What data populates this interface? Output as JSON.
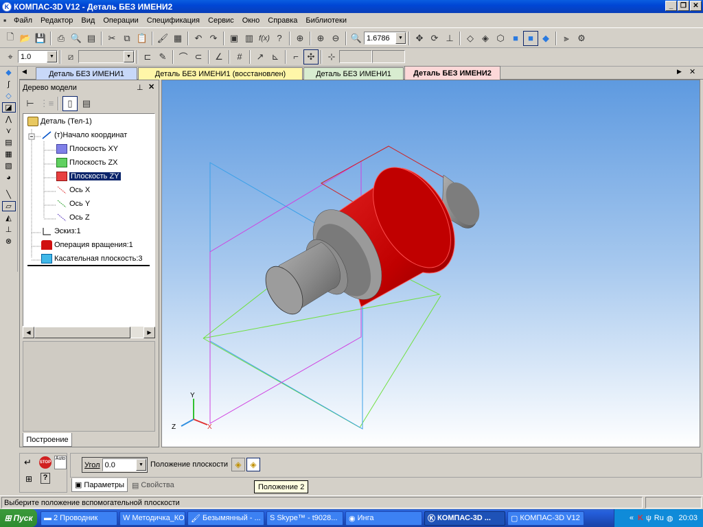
{
  "window": {
    "title": "КОМПАС-3D V12 - Деталь БЕЗ ИМЕНИ2",
    "app_icon": "kompas-icon"
  },
  "menu": [
    "Файл",
    "Редактор",
    "Вид",
    "Операции",
    "Спецификация",
    "Сервис",
    "Окно",
    "Справка",
    "Библиотеки"
  ],
  "toolbar": {
    "zoom_value": "1.6786",
    "line_scale_value": "1.0"
  },
  "doc_tabs": [
    {
      "label": "Деталь БЕЗ ИМЕНИ1",
      "color": "#c8d8f8"
    },
    {
      "label": "Деталь БЕЗ ИМЕНИ1 (восстановлен)",
      "color": "#fff6a8"
    },
    {
      "label": "Деталь БЕЗ ИМЕНИ1",
      "color": "#d8ecd0"
    },
    {
      "label": "Деталь БЕЗ ИМЕНИ2",
      "color": "#fcd8d8",
      "active": true
    }
  ],
  "tree": {
    "title": "Дерево модели",
    "pin": "ф",
    "close": "✕",
    "items": [
      {
        "label": "Деталь (Тел-1)"
      },
      {
        "label": "(т)Начало координат"
      },
      {
        "label": "Плоскость XY"
      },
      {
        "label": "Плоскость ZX"
      },
      {
        "label": "Плоскость ZY"
      },
      {
        "label": "Ось X"
      },
      {
        "label": "Ось Y"
      },
      {
        "label": "Ось Z"
      },
      {
        "label": "Эскиз:1"
      },
      {
        "label": "Операция вращения:1"
      },
      {
        "label": "Касательная плоскость:3"
      }
    ],
    "bottom_tab": "Построение"
  },
  "properties": {
    "angle_label": "Угол",
    "angle_value": "0.0",
    "position_label": "Положение плоскости",
    "tab_params": "Параметры",
    "tab_props": "Свойства",
    "tooltip": "Положение 2",
    "stop_label": "STOP",
    "auto_label": "Auto"
  },
  "axes": {
    "x": "X",
    "y": "Y",
    "z": "Z"
  },
  "status": {
    "text": "Выберите положение вспомогательной плоскости"
  },
  "taskbar": {
    "start": "Пуск",
    "items": [
      {
        "label": "2 Проводник"
      },
      {
        "label": "Методичка_КО..."
      },
      {
        "label": "Безымянный - ..."
      },
      {
        "label": "Skype™ - t9028..."
      },
      {
        "label": "Инга"
      },
      {
        "label": "КОМПАС-3D ..."
      },
      {
        "label": "КОМПАС-3D V12"
      }
    ],
    "lang": "Ru",
    "time": "20:03"
  }
}
